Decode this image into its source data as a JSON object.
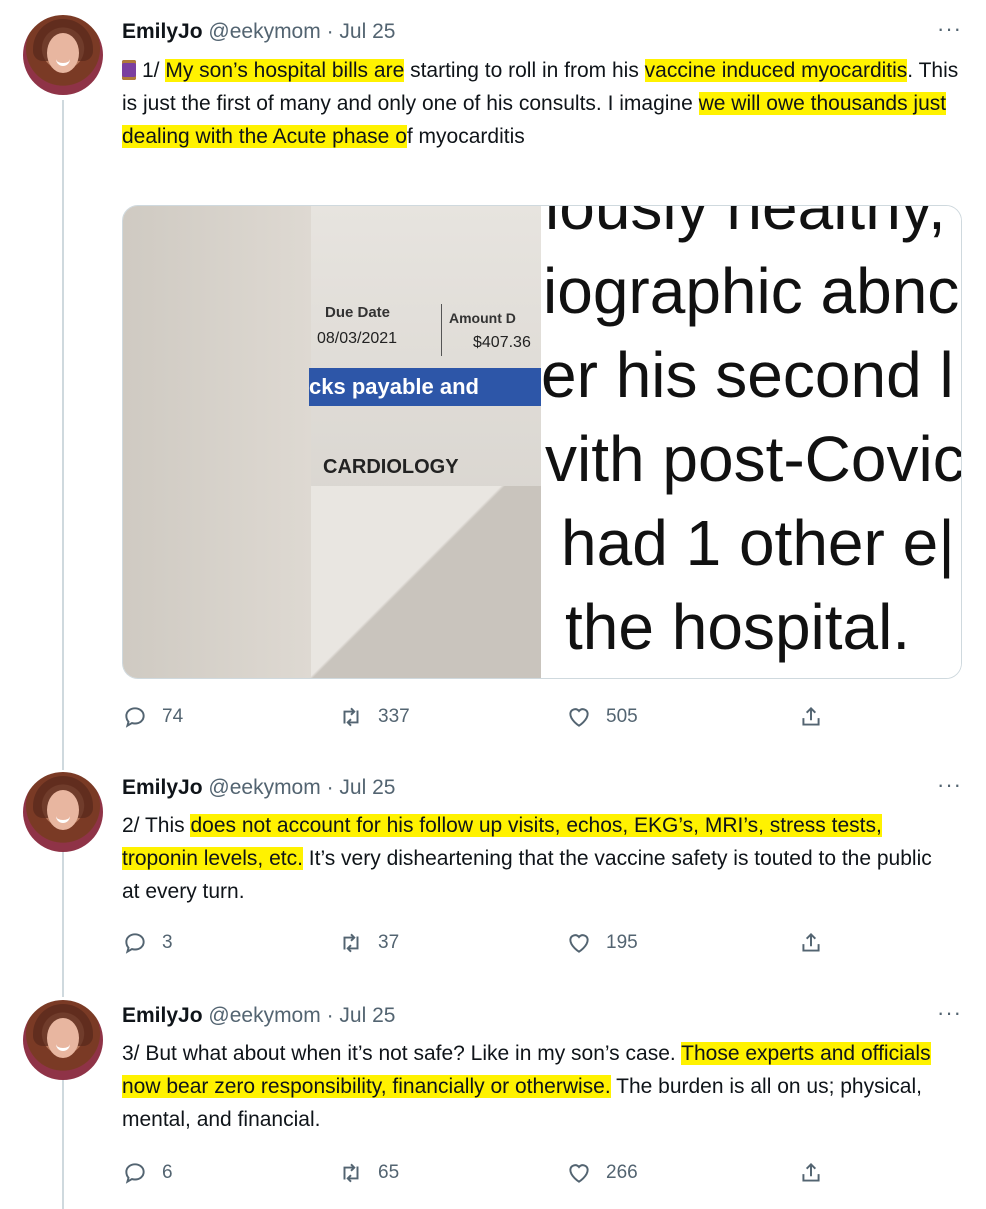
{
  "tweets": [
    {
      "name": "EmilyJo",
      "handle": "@eekymom",
      "sep": "·",
      "date": "Jul 25",
      "more": "···",
      "text": {
        "p1": "1/ ",
        "h1": "My son’s hospital bills are",
        "p2": " starting to roll in from his ",
        "h2": "vaccine induced myocarditis",
        "p3": ". This is just the first of many and only one of his consults. I imagine ",
        "h3": "we will owe thousands just dealing with the Acute phase o",
        "p4": "f myocarditis"
      },
      "replies": "74",
      "retweets": "337",
      "likes": "505"
    },
    {
      "name": "EmilyJo",
      "handle": "@eekymom",
      "sep": "·",
      "date": "Jul 25",
      "more": "···",
      "text": {
        "p1": "2/ This ",
        "h1": "does not account for his follow up visits, echos, EKG’s, MRI’s, stress tests, troponin levels, etc.",
        "p2": " It’s very disheartening that the vaccine safety is touted to the public at every turn."
      },
      "replies": "3",
      "retweets": "37",
      "likes": "195"
    },
    {
      "name": "EmilyJo",
      "handle": "@eekymom",
      "sep": "·",
      "date": "Jul 25",
      "more": "···",
      "text": {
        "p1": "3/ But what about when it’s not safe? Like in my son’s case. ",
        "h1": "Those experts and officials now bear zero responsibility, financially or otherwise.",
        "p2": " The burden is all on us; physical, mental, and financial."
      },
      "replies": "6",
      "retweets": "65",
      "likes": "266"
    }
  ],
  "media": {
    "bill": {
      "due_label": "Due Date",
      "due_date": "08/03/2021",
      "amount_label": "Amount D",
      "amount_value": "$407.36",
      "payable": "cks payable and",
      "department": "CARDIOLOGY"
    },
    "document_lines": [
      "iously healthy,",
      "iographic abnc",
      "er his second l",
      "vith post-Covic",
      "had 1 other e|",
      "the hospital."
    ]
  },
  "colors": {
    "highlight": "#fff200",
    "muted": "#536471",
    "thread_line": "#cfd9de"
  }
}
